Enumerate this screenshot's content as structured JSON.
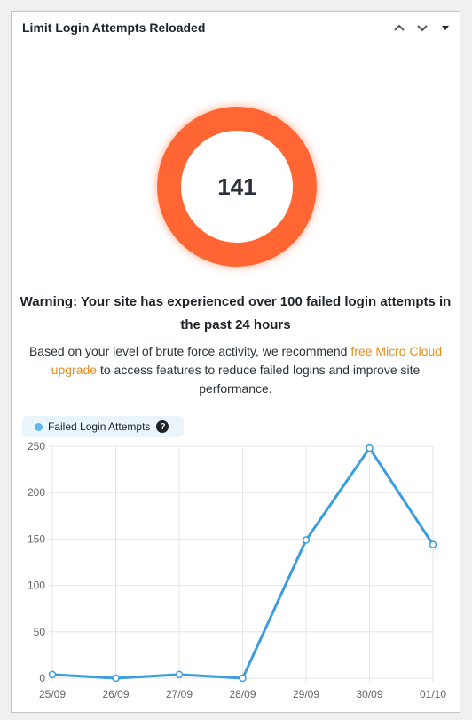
{
  "widget": {
    "title": "Limit Login Attempts Reloaded",
    "controls": [
      "move-up",
      "move-down",
      "toggle"
    ]
  },
  "summary": {
    "failed_count": "141",
    "ring_color": "#ff6633",
    "warning": "Warning: Your site has experienced over 100 failed login attempts in the past 24 hours",
    "recommend_before": "Based on your level of brute force activity, we recommend ",
    "recommend_link": "free Micro Cloud upgrade",
    "recommend_after": " to access features to reduce failed logins and improve site performance.",
    "link_color": "#e88c18"
  },
  "legend": {
    "label": "Failed Login Attempts",
    "help": "?",
    "dot_color": "#5fb6ef"
  },
  "chart_data": {
    "type": "line",
    "categories": [
      "25/09",
      "26/09",
      "27/09",
      "28/09",
      "29/09",
      "30/09",
      "01/10"
    ],
    "series": [
      {
        "name": "Failed Login Attempts",
        "values": [
          4,
          0,
          4,
          0,
          149,
          248,
          144
        ],
        "color": "#3b9ddd"
      }
    ],
    "ylim": [
      0,
      250
    ],
    "yticks": [
      0,
      50,
      100,
      150,
      200,
      250
    ],
    "grid": true,
    "legend_position": "top-left"
  }
}
